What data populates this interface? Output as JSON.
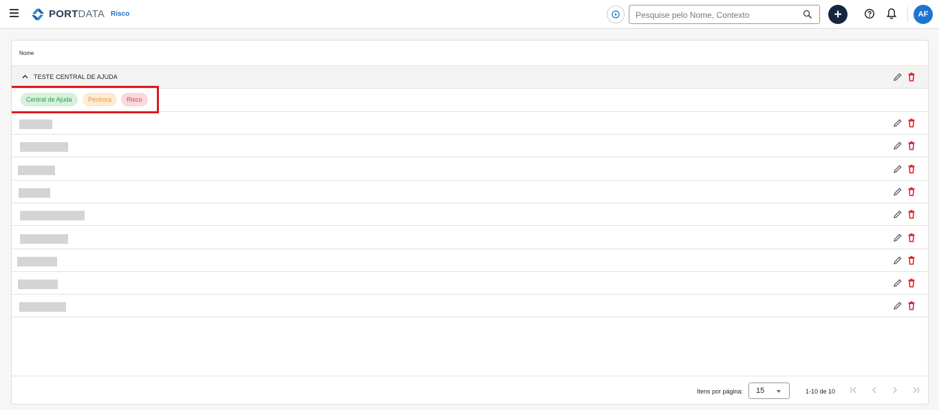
{
  "header": {
    "brand_bold": "PORT",
    "brand_light": "DATA",
    "context": "Risco",
    "search": {
      "placeholder": "Pesquise pelo Nome, Contexto",
      "value": ""
    },
    "add_label": "+",
    "avatar_initials": "AF"
  },
  "table": {
    "column_header": "Nome",
    "group": {
      "title": "TESTE CENTRAL DE AJUDA",
      "tags": [
        {
          "label": "Central de Ajuda",
          "color": "#2f9a48"
        },
        {
          "label": "Penhora",
          "color": "#e89a2a"
        },
        {
          "label": "Risco",
          "color": "#d1404d"
        }
      ]
    },
    "rows_redacted": 9
  },
  "footer": {
    "items_per_page_label": "Itens por página:",
    "items_per_page_value": "15",
    "range_label": "1-10 de 10"
  },
  "colors": {
    "accent": "#1e74d0",
    "delete": "#e0161e",
    "highlight": "#e0161e",
    "add_button": "#152740"
  }
}
